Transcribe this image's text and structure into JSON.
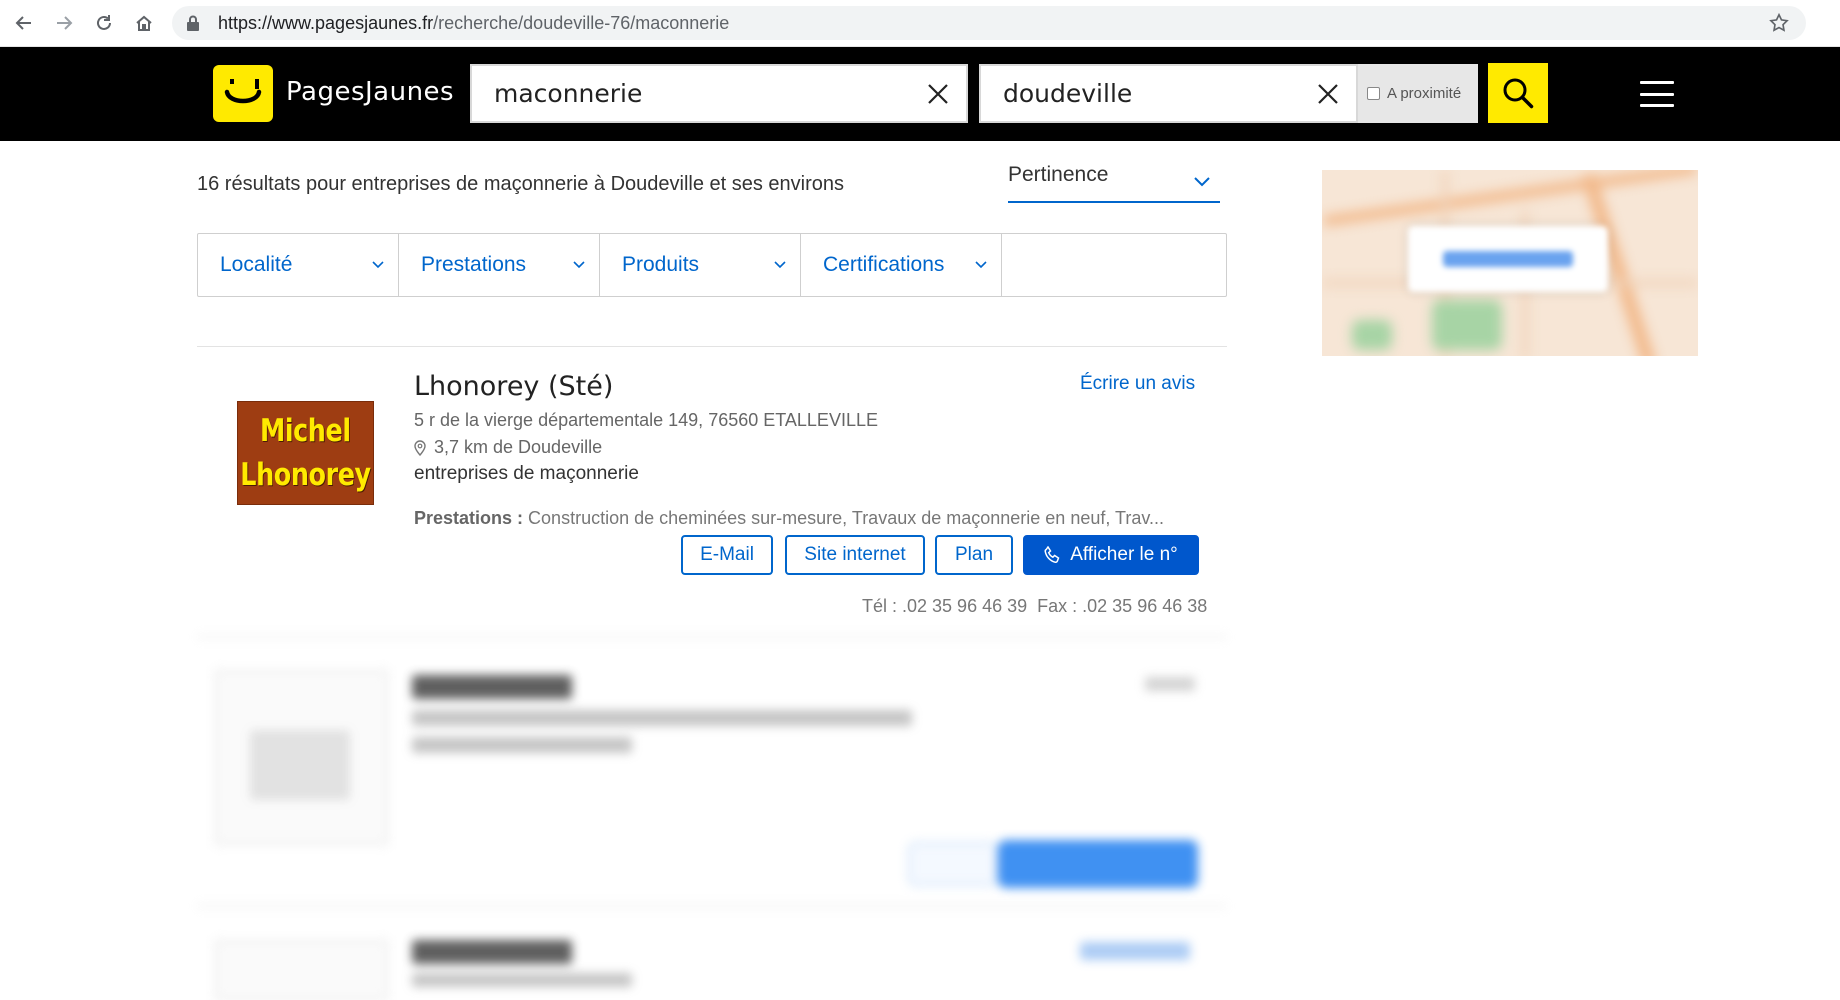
{
  "browser": {
    "url_host": "https://www.pagesjaunes.fr",
    "url_path": "/recherche/doudeville-76/maconnerie"
  },
  "header": {
    "logo_text": "PagesJaunes",
    "what_value": "maconnerie",
    "where_value": "doudeville",
    "proximity_label": "A proximité"
  },
  "results": {
    "count_text": "16 résultats pour entreprises de maçonnerie à Doudeville et ses environs",
    "sort_label": "Pertinence"
  },
  "filters": [
    {
      "label": "Localité"
    },
    {
      "label": "Prestations"
    },
    {
      "label": "Produits"
    },
    {
      "label": "Certifications"
    }
  ],
  "listing": {
    "logo_line1": "Michel",
    "logo_line2": "Lhonorey",
    "name": "Lhonorey (Sté)",
    "write_review": "Écrire un avis",
    "address": "5 r de la vierge départementale 149, 76560 ETALLEVILLE",
    "distance": "3,7 km de Doudeville",
    "category": "entreprises de maçonnerie",
    "prestations_label": "Prestations :",
    "prestations_text": "Construction de cheminées sur-mesure, Travaux de maçonnerie en neuf, Trav...",
    "buttons": {
      "email": "E-Mail",
      "website": "Site internet",
      "map": "Plan",
      "phone": "Afficher le n°"
    },
    "tel": "Tél : .02 35 96 46 39",
    "fax": "Fax : .02 35 96 46 38"
  },
  "colors": {
    "brand_yellow": "#ffea00",
    "link_blue": "#0066cc",
    "button_blue": "#0057cc",
    "header_bg": "#000000"
  }
}
